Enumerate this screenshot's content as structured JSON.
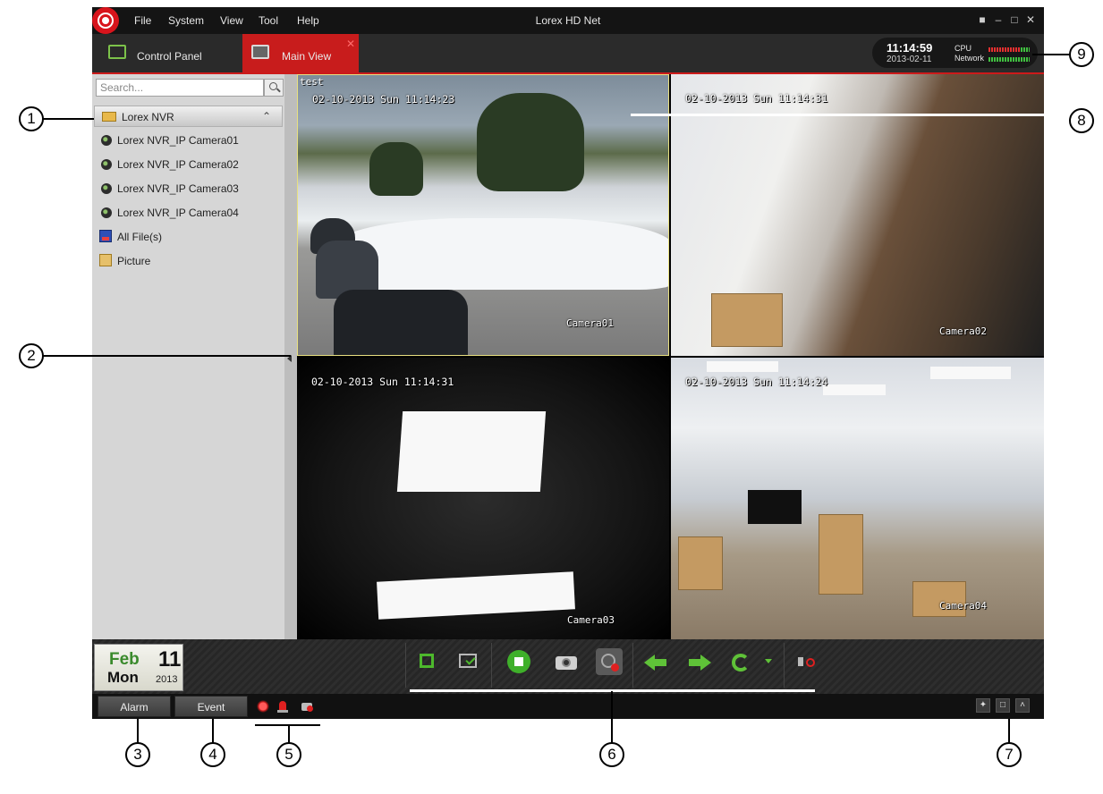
{
  "app": {
    "title": "Lorex HD Net",
    "menu": [
      "File",
      "System",
      "View",
      "Tool",
      "Help"
    ]
  },
  "tabs": [
    {
      "label": "Control Panel",
      "active": false
    },
    {
      "label": "Main View",
      "active": true
    }
  ],
  "status": {
    "time": "11:14:59",
    "date": "2013-02-11",
    "cpu_label": "CPU",
    "network_label": "Network"
  },
  "sidebar": {
    "search_placeholder": "Search...",
    "group": "Lorex NVR",
    "cameras": [
      "Lorex NVR_IP Camera01",
      "Lorex NVR_IP Camera02",
      "Lorex NVR_IP Camera03",
      "Lorex NVR_IP Camera04"
    ],
    "all_files": "All File(s)",
    "picture": "Picture"
  },
  "tiles": [
    {
      "tag": "test",
      "timestamp": "02-10-2013 Sun 11:14:23",
      "camera": "Camera01"
    },
    {
      "timestamp": "02-10-2013 Sun 11:14:31",
      "camera": "Camera02"
    },
    {
      "timestamp": "02-10-2013 Sun 11:14:31",
      "camera": "Camera03"
    },
    {
      "timestamp": "02-10-2013 Sun 11:14:24",
      "camera": "Camera04"
    }
  ],
  "date_widget": {
    "month": "Feb",
    "day": "11",
    "weekday": "Mon",
    "year": "2013"
  },
  "bottom": {
    "alarm": "Alarm",
    "event": "Event"
  },
  "callouts": [
    "1",
    "2",
    "3",
    "4",
    "5",
    "6",
    "7",
    "8",
    "9"
  ],
  "colors": {
    "accent": "#c81c1c",
    "brand_green": "#4db82c",
    "selected_tile_border": "#e8e080"
  },
  "icons": [
    "lorex-logo-icon",
    "lock-icon",
    "minimize-icon",
    "maximize-icon",
    "close-icon",
    "search-icon",
    "folder-icon",
    "camera-icon",
    "files-icon",
    "picture-icon",
    "fullscreen-icon",
    "layout-icon",
    "stop-all-icon",
    "capture-icon",
    "record-icon",
    "previous-page-icon",
    "next-page-icon",
    "auto-switch-icon",
    "audio-mute-icon",
    "pin-icon",
    "restore-icon",
    "expand-icon"
  ]
}
